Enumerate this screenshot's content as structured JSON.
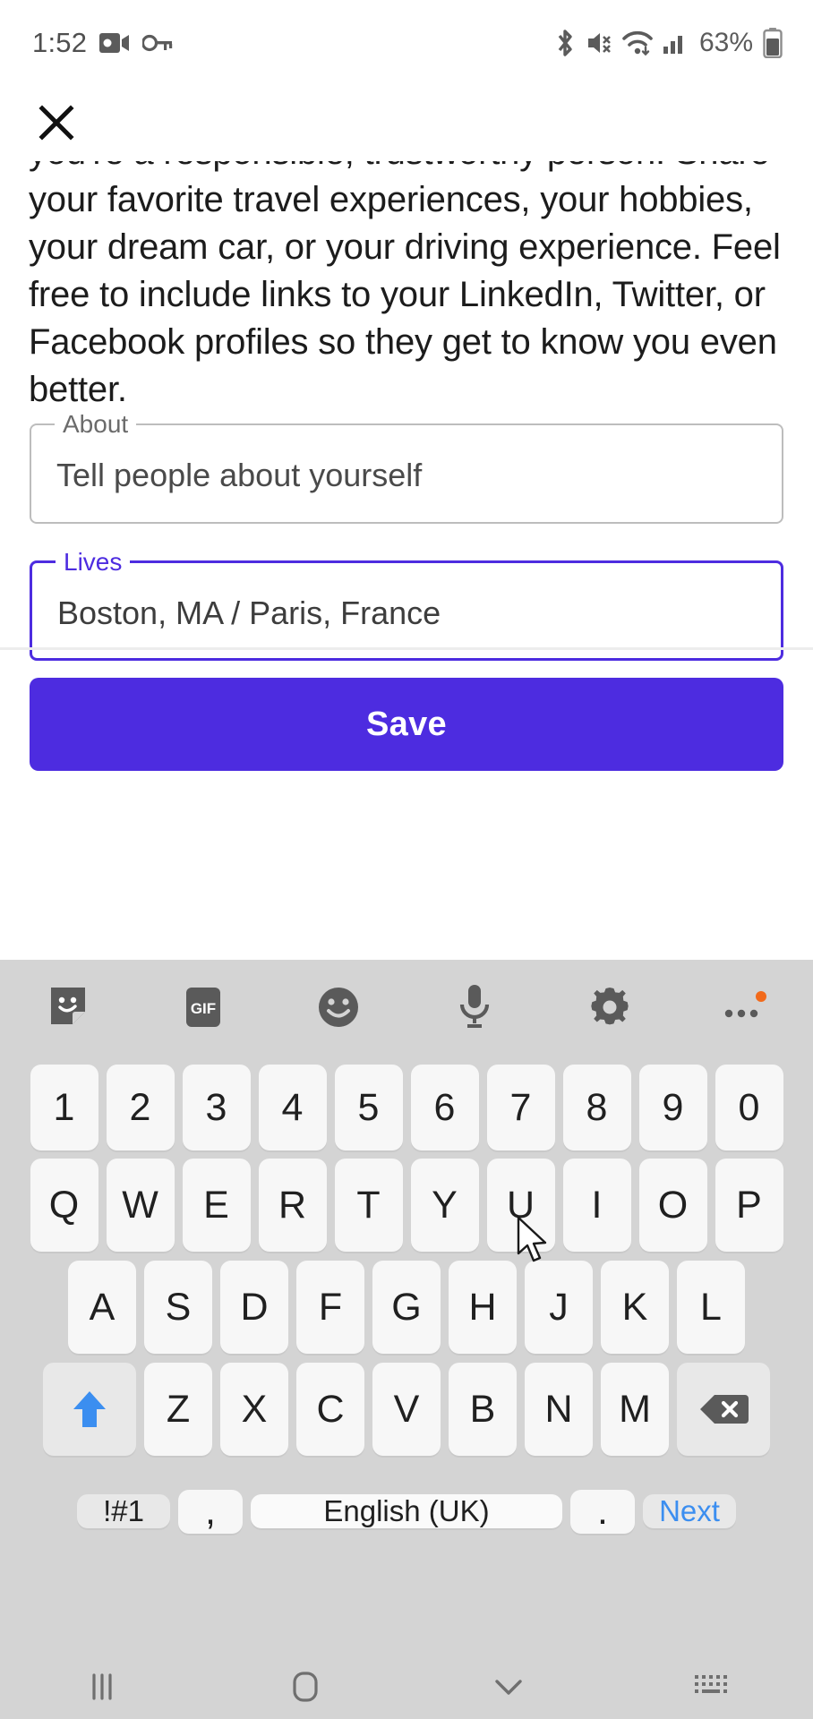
{
  "statusbar": {
    "time": "1:52",
    "icons_left": [
      "video-recording-icon",
      "vpn-key-icon"
    ],
    "icons_right": [
      "bluetooth-icon",
      "mute-icon",
      "wifi-icon",
      "cellular-signal-icon"
    ],
    "battery_text": "63%",
    "battery_icon": "battery-icon"
  },
  "header": {
    "close_icon": "close-icon"
  },
  "content": {
    "blurb": "you're a responsible, trustworthy person. Share your favorite travel experiences, your hobbies, your dream car, or your driving experience. Feel free to include links to your LinkedIn, Twitter, or Facebook profiles so they get to know you even better."
  },
  "form": {
    "about": {
      "label": "About",
      "value": "",
      "placeholder": "Tell people about yourself",
      "focused": false
    },
    "lives": {
      "label": "Lives",
      "value": "Boston, MA / Paris, France",
      "placeholder": "Lives",
      "focused": true
    },
    "save_label": "Save",
    "accent_color": "#4d2ce0"
  },
  "keyboard": {
    "toolbar": [
      {
        "name": "sticker-icon",
        "label": ""
      },
      {
        "name": "gif-icon",
        "label": "GIF"
      },
      {
        "name": "emoji-icon",
        "label": ""
      },
      {
        "name": "microphone-icon",
        "label": ""
      },
      {
        "name": "keyboard-settings-icon",
        "label": ""
      },
      {
        "name": "more-options-icon",
        "label": ""
      }
    ],
    "rows": {
      "numbers": [
        "1",
        "2",
        "3",
        "4",
        "5",
        "6",
        "7",
        "8",
        "9",
        "0"
      ],
      "top": [
        "Q",
        "W",
        "E",
        "R",
        "T",
        "Y",
        "U",
        "I",
        "O",
        "P"
      ],
      "home": [
        "A",
        "S",
        "D",
        "F",
        "G",
        "H",
        "J",
        "K",
        "L"
      ],
      "bottom": [
        "Z",
        "X",
        "C",
        "V",
        "B",
        "N",
        "M"
      ]
    },
    "shift_icon": "shift-arrow-icon",
    "backspace_icon": "backspace-icon",
    "symbols_key": "!#1",
    "comma_key": ",",
    "space_key": "English (UK)",
    "period_key": ".",
    "next_key": "Next",
    "next_color": "#3b8ef0",
    "shift_color": "#3b8ef0"
  },
  "navbar": {
    "items": [
      {
        "name": "recents-icon"
      },
      {
        "name": "home-icon"
      },
      {
        "name": "hide-keyboard-icon"
      },
      {
        "name": "keyboard-switch-icon"
      }
    ]
  }
}
